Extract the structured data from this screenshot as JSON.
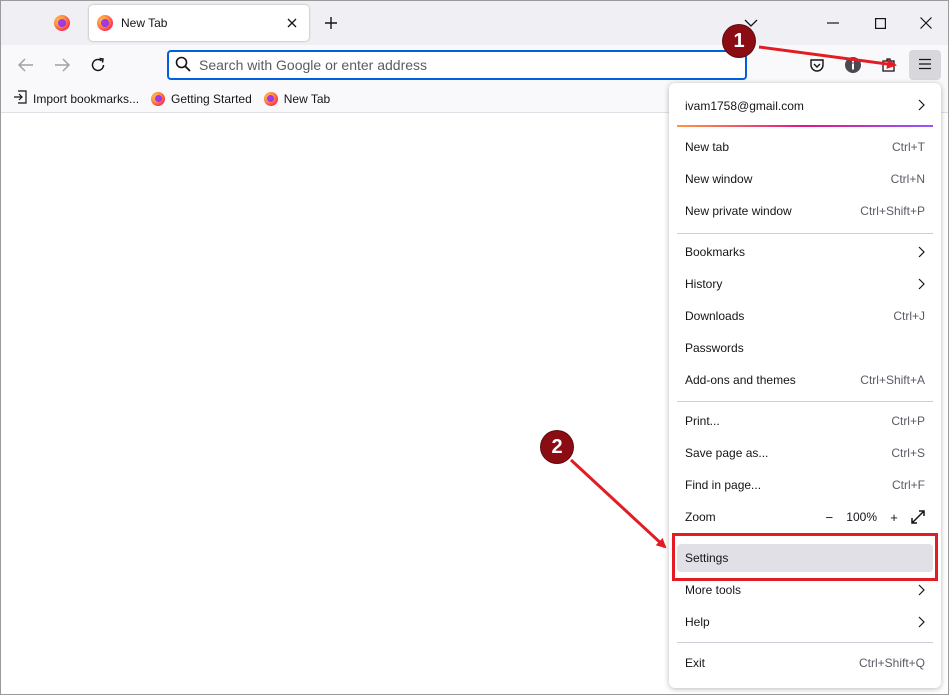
{
  "tabs": {
    "active_title": "New Tab"
  },
  "urlbar": {
    "placeholder": "Search with Google or enter address"
  },
  "bookmarks": [
    {
      "label": "Import bookmarks...",
      "icon": "import-icon"
    },
    {
      "label": "Getting Started",
      "icon": "firefox-icon"
    },
    {
      "label": "New Tab",
      "icon": "firefox-icon"
    }
  ],
  "menu": {
    "account": "ivam1758@gmail.com",
    "items": [
      {
        "label": "New tab",
        "shortcut": "Ctrl+T"
      },
      {
        "label": "New window",
        "shortcut": "Ctrl+N"
      },
      {
        "label": "New private window",
        "shortcut": "Ctrl+Shift+P"
      },
      {
        "label": "Bookmarks",
        "shortcut": ""
      },
      {
        "label": "History",
        "shortcut": ""
      },
      {
        "label": "Downloads",
        "shortcut": "Ctrl+J"
      },
      {
        "label": "Passwords",
        "shortcut": ""
      },
      {
        "label": "Add-ons and themes",
        "shortcut": "Ctrl+Shift+A"
      },
      {
        "label": "Print...",
        "shortcut": "Ctrl+P"
      },
      {
        "label": "Save page as...",
        "shortcut": "Ctrl+S"
      },
      {
        "label": "Find in page...",
        "shortcut": "Ctrl+F"
      },
      {
        "label": "Zoom",
        "shortcut": ""
      },
      {
        "label": "Settings",
        "shortcut": ""
      },
      {
        "label": "More tools",
        "shortcut": ""
      },
      {
        "label": "Help",
        "shortcut": ""
      },
      {
        "label": "Exit",
        "shortcut": "Ctrl+Shift+Q"
      }
    ],
    "zoom_minus": "−",
    "zoom_value": "100%",
    "zoom_plus": "+"
  },
  "annotations": {
    "step1": "1",
    "step2": "2",
    "color": "#e31c23",
    "badge_color": "#8b0d13"
  },
  "colors": {
    "accent": "#0061e0",
    "hover": "#e0e0e6"
  }
}
